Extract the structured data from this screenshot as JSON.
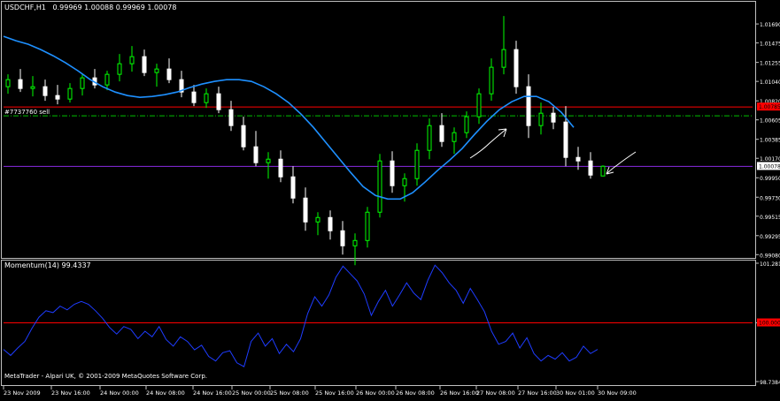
{
  "header": {
    "symbol": "USDCHF,H1",
    "ohlc": "0.99969 1.00088 0.99969 1.00078"
  },
  "footer": {
    "copyright": "MetaTrader - Alpari UK, © 2001-2009 MetaQuotes Software Corp."
  },
  "colors": {
    "background": "#000000",
    "frame": "#c0c0c0",
    "bull_candle": "#00ff00",
    "bear_candle": "#ffffff",
    "moving_average": "#1e90ff",
    "momentum_line": "#1e3cff",
    "resistance_line": "#ff0000",
    "order_line": "#00c000",
    "current_price_line": "#8a2be2",
    "arrow": "#ffffff",
    "text": "#ffffff"
  },
  "chart_data": [
    {
      "type": "candlestick",
      "title": "USDCHF,H1",
      "ylim": [
        0.99083,
        1.01781
      ],
      "y_ticks": [
        "1.01690",
        "1.01475",
        "1.01255",
        "1.01040",
        "1.00820",
        "1.00605",
        "1.00385",
        "1.00170",
        "0.99950",
        "0.99730",
        "0.99515",
        "0.99295",
        "0.99080"
      ],
      "x_ticks": [
        "23 Nov 2009",
        "23 Nov 16:00",
        "24 Nov 00:00",
        "24 Nov 08:00",
        "24 Nov 16:00",
        "25 Nov 00:00",
        "25 Nov 08:00",
        "25 Nov 16:00",
        "26 Nov 00:00",
        "26 Nov 08:00",
        "26 Nov 16:00",
        "27 Nov 08:00",
        "27 Nov 16:00",
        "30 Nov 01:00",
        "30 Nov 09:00"
      ],
      "order_label": "#7737760 sell",
      "order_level": 1.0065,
      "resistance_level": 1.0075,
      "current_price": 1.00078,
      "current_price_label": "1.00078",
      "resistance_label": "1.00785",
      "moving_average": [
        1.0155,
        1.015,
        1.0146,
        1.014,
        1.0133,
        1.0125,
        1.0116,
        1.0106,
        1.0098,
        1.0092,
        1.0088,
        1.0086,
        1.0087,
        1.0089,
        1.0092,
        1.0097,
        1.0101,
        1.0104,
        1.0106,
        1.0106,
        1.0104,
        1.0098,
        1.009,
        1.008,
        1.0067,
        1.0052,
        1.0035,
        1.0018,
        1.0001,
        0.9985,
        0.9975,
        0.9971,
        0.9971,
        0.9978,
        0.999,
        1.0003,
        1.0015,
        1.0028,
        1.0044,
        1.0059,
        1.0072,
        1.0081,
        1.0087,
        1.0087,
        1.0081,
        1.0069,
        1.0052
      ],
      "candles": [
        [
          1.0098,
          1.0112,
          1.009,
          1.0106
        ],
        [
          1.0106,
          1.0118,
          1.0092,
          1.0096
        ],
        [
          1.0096,
          1.011,
          1.0087,
          1.0098
        ],
        [
          1.0098,
          1.0106,
          1.0082,
          1.0088
        ],
        [
          1.0088,
          1.01,
          1.0078,
          1.0084
        ],
        [
          1.0084,
          1.0102,
          1.008,
          1.0096
        ],
        [
          1.0096,
          1.0112,
          1.0088,
          1.0108
        ],
        [
          1.0108,
          1.0118,
          1.0096,
          1.01
        ],
        [
          1.01,
          1.0116,
          1.0094,
          1.0112
        ],
        [
          1.0112,
          1.0135,
          1.0104,
          1.0124
        ],
        [
          1.0124,
          1.0144,
          1.0115,
          1.0132
        ],
        [
          1.0132,
          1.014,
          1.011,
          1.0114
        ],
        [
          1.0114,
          1.0124,
          1.0098,
          1.0118
        ],
        [
          1.0118,
          1.013,
          1.0102,
          1.0106
        ],
        [
          1.0106,
          1.0116,
          1.0086,
          1.0092
        ],
        [
          1.0092,
          1.01,
          1.0076,
          1.008
        ],
        [
          1.008,
          1.0096,
          1.0074,
          1.009
        ],
        [
          1.009,
          1.0098,
          1.0068,
          1.0072
        ],
        [
          1.0072,
          1.0082,
          1.0048,
          1.0054
        ],
        [
          1.0054,
          1.0064,
          1.0026,
          1.003
        ],
        [
          1.003,
          1.0048,
          1.0008,
          1.0012
        ],
        [
          1.0012,
          1.0024,
          0.9994,
          1.0016
        ],
        [
          1.0016,
          1.0026,
          0.999,
          0.9996
        ],
        [
          0.9996,
          1.0008,
          0.9966,
          0.9972
        ],
        [
          0.9972,
          0.9984,
          0.9935,
          0.9945
        ],
        [
          0.9945,
          0.9956,
          0.993,
          0.995
        ],
        [
          0.995,
          0.9958,
          0.9925,
          0.9935
        ],
        [
          0.9935,
          0.9946,
          0.9908,
          0.9918
        ],
        [
          0.9918,
          0.9932,
          0.9896,
          0.9924
        ],
        [
          0.9924,
          0.9962,
          0.9916,
          0.9956
        ],
        [
          0.9956,
          1.0022,
          0.995,
          1.0014
        ],
        [
          1.0014,
          1.0025,
          0.9978,
          0.9986
        ],
        [
          0.9986,
          1.0,
          0.9968,
          0.9994
        ],
        [
          0.9994,
          1.0034,
          0.9986,
          1.0026
        ],
        [
          1.0026,
          1.0062,
          1.0016,
          1.0054
        ],
        [
          1.0054,
          1.0068,
          1.003,
          1.0036
        ],
        [
          1.0036,
          1.0052,
          1.0022,
          1.0046
        ],
        [
          1.0046,
          1.007,
          1.004,
          1.0064
        ],
        [
          1.0064,
          1.0096,
          1.0056,
          1.009
        ],
        [
          1.009,
          1.013,
          1.0082,
          1.012
        ],
        [
          1.012,
          1.0178,
          1.0112,
          1.014
        ],
        [
          1.014,
          1.015,
          1.009,
          1.0098
        ],
        [
          1.0098,
          1.0112,
          1.004,
          1.0054
        ],
        [
          1.0054,
          1.008,
          1.0044,
          1.0068
        ],
        [
          1.0068,
          1.0075,
          1.005,
          1.0058
        ],
        [
          1.0058,
          1.0076,
          1.0008,
          1.0018
        ],
        [
          1.0018,
          1.003,
          1.0004,
          1.0014
        ],
        [
          1.0014,
          1.0024,
          0.9994,
          0.9998
        ],
        [
          0.9997,
          1.0009,
          0.9997,
          1.0008
        ]
      ]
    },
    {
      "type": "line",
      "title": "Momentum(14) 99.4337",
      "ylim": [
        98.7384,
        101.2818
      ],
      "y_ticks": [
        "101.2818",
        "100.0000",
        "98.7384"
      ],
      "reference_level": 100.0,
      "series": [
        {
          "name": "Momentum(14)",
          "values": [
            99.43,
            99.3,
            99.46,
            99.6,
            99.88,
            100.12,
            100.26,
            100.22,
            100.36,
            100.28,
            100.4,
            100.46,
            100.4,
            100.26,
            100.1,
            99.9,
            99.76,
            99.92,
            99.86,
            99.66,
            99.82,
            99.7,
            99.92,
            99.64,
            99.5,
            99.7,
            99.6,
            99.42,
            99.52,
            99.28,
            99.18,
            99.36,
            99.4,
            99.14,
            99.06,
            99.6,
            99.78,
            99.5,
            99.66,
            99.34,
            99.54,
            99.38,
            99.66,
            100.2,
            100.56,
            100.36,
            100.6,
            100.98,
            101.22,
            101.06,
            100.9,
            100.62,
            100.16,
            100.46,
            100.7,
            100.36,
            100.6,
            100.86,
            100.64,
            100.5,
            100.92,
            101.24,
            101.08,
            100.86,
            100.7,
            100.42,
            100.74,
            100.5,
            100.24,
            99.82,
            99.54,
            99.6,
            99.78,
            99.46,
            99.68,
            99.34,
            99.18,
            99.3,
            99.22,
            99.36,
            99.18,
            99.26,
            99.5,
            99.34,
            99.43
          ]
        }
      ]
    }
  ]
}
